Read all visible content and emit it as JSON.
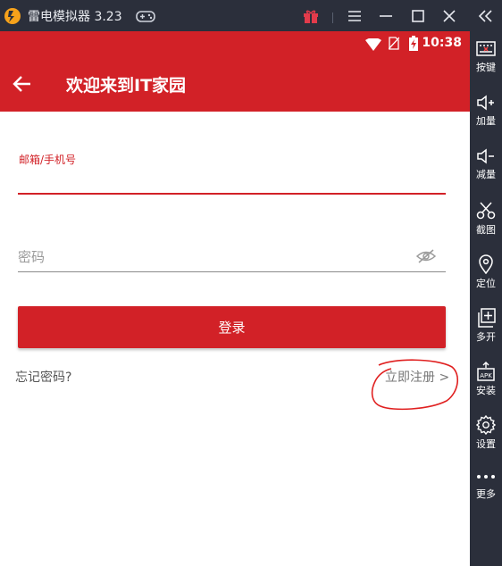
{
  "window": {
    "title": "雷电模拟器 3.23"
  },
  "status_bar": {
    "time": "10:38"
  },
  "app_bar": {
    "title": "欢迎来到IT家园"
  },
  "login_form": {
    "email_label": "邮箱/手机号",
    "email_value": "",
    "password_placeholder": "密码",
    "password_value": "",
    "login_button": "登录",
    "forgot_link": "忘记密码?",
    "register_link": "立即注册 >"
  },
  "sidebar": {
    "items": [
      {
        "label": "按键",
        "icon": "keyboard-icon"
      },
      {
        "label": "加量",
        "icon": "volume-up-icon"
      },
      {
        "label": "减量",
        "icon": "volume-down-icon"
      },
      {
        "label": "截图",
        "icon": "scissors-icon"
      },
      {
        "label": "定位",
        "icon": "location-pin-icon"
      },
      {
        "label": "多开",
        "icon": "multi-instance-icon"
      },
      {
        "label": "安装",
        "icon": "apk-install-icon"
      },
      {
        "label": "设置",
        "icon": "gear-icon"
      },
      {
        "label": "更多",
        "icon": "more-dots-icon"
      }
    ]
  },
  "colors": {
    "brand_red": "#d22127",
    "emulator_chrome": "#2b2f3b",
    "gift_icon": "#e23b4b",
    "annotation_circle": "#e02020"
  }
}
